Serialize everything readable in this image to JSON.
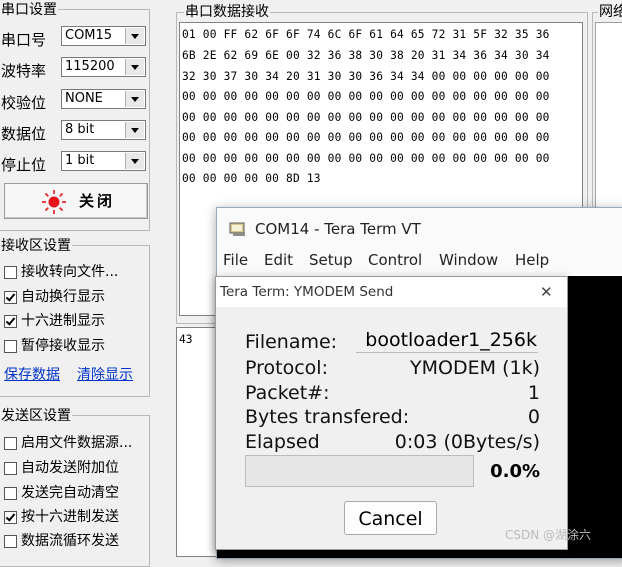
{
  "serial_settings": {
    "group_title": "串口设置",
    "port_label": "串口号",
    "port_value": "COM15",
    "baud_label": "波特率",
    "baud_value": "115200",
    "parity_label": "校验位",
    "parity_value": "NONE",
    "databits_label": "数据位",
    "databits_value": "8 bit",
    "stopbits_label": "停止位",
    "stopbits_value": "1 bit",
    "close_button_label": "关闭"
  },
  "receive_settings": {
    "group_title": "接收区设置",
    "options": [
      {
        "label": "接收转向文件...",
        "checked": false
      },
      {
        "label": "自动换行显示",
        "checked": true
      },
      {
        "label": "十六进制显示",
        "checked": true
      },
      {
        "label": "暂停接收显示",
        "checked": false
      }
    ],
    "save_link": "保存数据",
    "clear_link": "清除显示"
  },
  "send_settings": {
    "group_title": "发送区设置",
    "options": [
      {
        "label": "启用文件数据源...",
        "checked": false
      },
      {
        "label": "自动发送附加位",
        "checked": false
      },
      {
        "label": "发送完自动清空",
        "checked": false
      },
      {
        "label": "按十六进制发送",
        "checked": true
      },
      {
        "label": "数据流循环发送",
        "checked": false
      }
    ]
  },
  "receive_area": {
    "group_title": "串口数据接收",
    "rows": [
      "01 00 FF 62 6F 6F 74 6C 6F 61 64 65 72 31 5F 32 35 36",
      "6B 2E 62 69 6E 00 32 36 38 30 38 20 31 34 36 34 30 34",
      "32 30 37 30 34 20 31 30 30 36 34 34 00 00 00 00 00 00",
      "00 00 00 00 00 00 00 00 00 00 00 00 00 00 00 00 00 00",
      "00 00 00 00 00 00 00 00 00 00 00 00 00 00 00 00 00 00",
      "00 00 00 00 00 00 00 00 00 00 00 00 00 00 00 00 00 00",
      "00 00 00 00 00 00 00 00 00 00 00 00 00 00 00 00 00 00",
      "00 00 00 00 00 8D 13"
    ]
  },
  "network_group_title": "网络",
  "send_area_value": "43",
  "teraterm": {
    "title": "COM14 - Tera Term VT",
    "menu": [
      "File",
      "Edit",
      "Setup",
      "Control",
      "Window",
      "Help"
    ]
  },
  "ymodem_dialog": {
    "title": "Tera Term: YMODEM Send",
    "close_glyph": "✕",
    "filename_label": "Filename:",
    "filename_value": "bootloader1_256k",
    "protocol_label": "Protocol:",
    "protocol_value": "YMODEM (1k)",
    "packet_label": "Packet#:",
    "packet_value": "1",
    "bytes_label": "Bytes transfered:",
    "bytes_value": "0",
    "elapsed_label": "Elapsed",
    "elapsed_value": "0:03 (0Bytes/s)",
    "progress_percent": "0.0%",
    "progress_fraction": 0.0,
    "cancel_label": "Cancel"
  },
  "watermark": "CSDN @湖涂六",
  "colors": {
    "link": "#0033cc",
    "led_red": "#e8141c",
    "terminal_bg": "#000000"
  }
}
